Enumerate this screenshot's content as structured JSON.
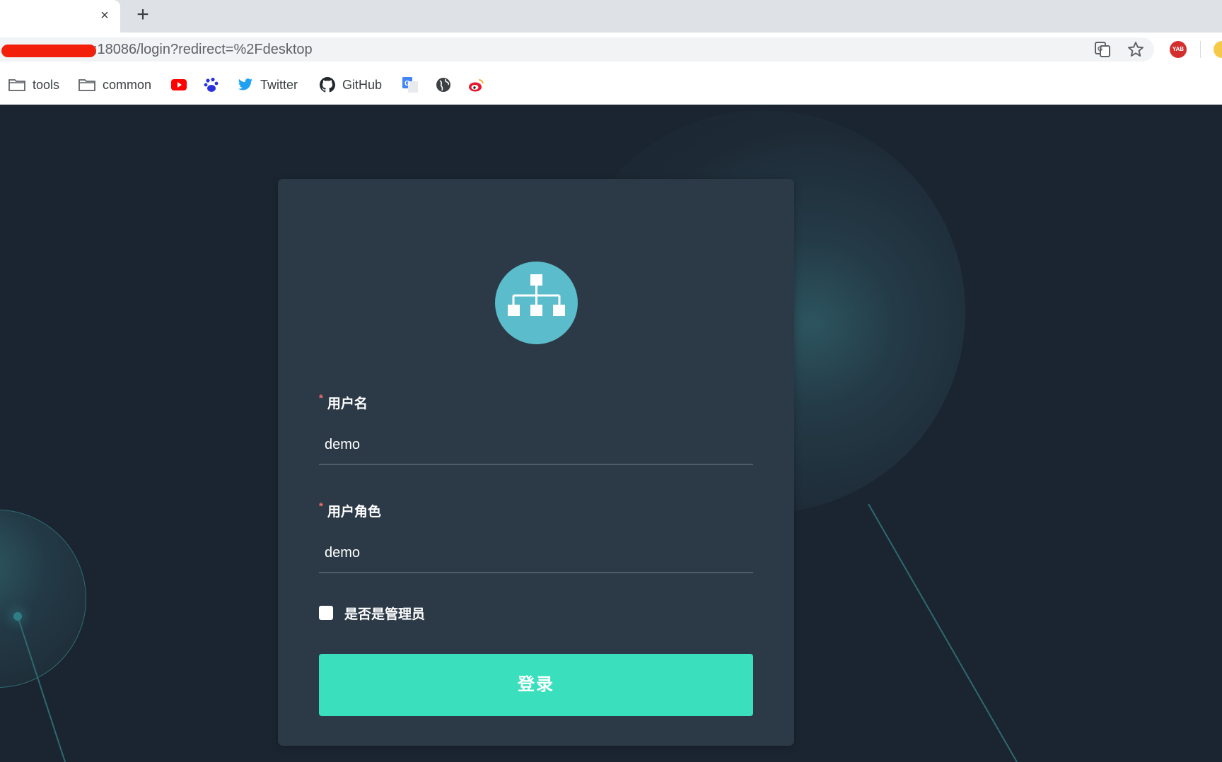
{
  "browser": {
    "tab": {
      "close_glyph": "×"
    },
    "new_tab_glyph": "+",
    "address_bar": {
      "url": ":18086/login?redirect=%2Fdesktop"
    },
    "icons": [
      "translate-icon",
      "star-icon",
      "yab-extension-icon",
      "emoji-extension-icon"
    ],
    "yab_badge": "YAB",
    "bookmarks": [
      {
        "label": "tools",
        "icon": "folder-icon"
      },
      {
        "label": "common",
        "icon": "folder-icon"
      },
      {
        "label": "",
        "icon": "youtube-icon"
      },
      {
        "label": "",
        "icon": "baidu-icon"
      },
      {
        "label": "Twitter",
        "icon": "twitter-icon"
      },
      {
        "label": "GitHub",
        "icon": "github-icon"
      },
      {
        "label": "",
        "icon": "google-translate-icon"
      },
      {
        "label": "",
        "icon": "globe-icon"
      },
      {
        "label": "",
        "icon": "weibo-icon"
      }
    ]
  },
  "login": {
    "logo_icon": "sitemap-icon",
    "username": {
      "label": "用户名",
      "required_mark": "*",
      "value": "demo"
    },
    "role": {
      "label": "用户角色",
      "required_mark": "*",
      "value": "demo"
    },
    "admin_checkbox": {
      "label": "是否是管理员",
      "checked": false
    },
    "submit_label": "登录"
  },
  "colors": {
    "page_bg": "#1b2532",
    "card_bg": "#2c3a47",
    "logo_bg": "#5bbccb",
    "button_bg": "#3ae0bd",
    "required": "#f56c6c"
  }
}
